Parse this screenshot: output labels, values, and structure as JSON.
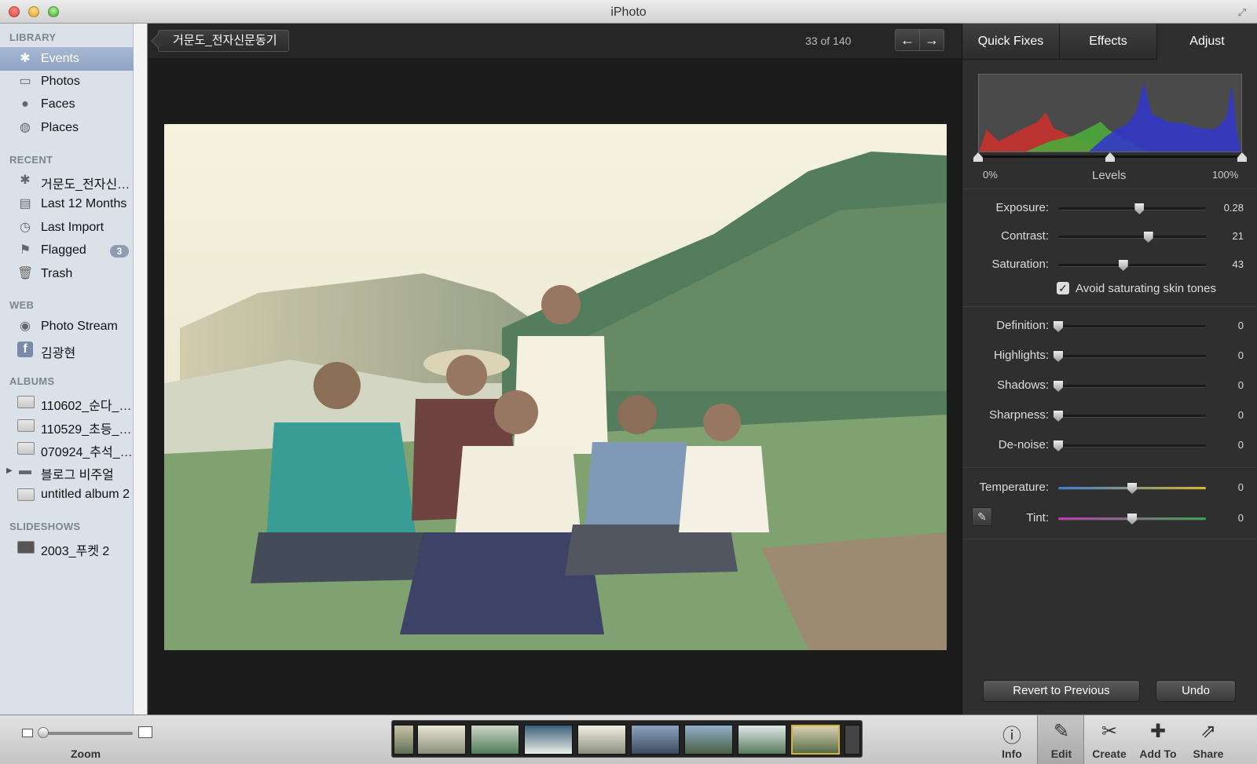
{
  "window": {
    "title": "iPhoto"
  },
  "sidebar": {
    "library_header": "LIBRARY",
    "library": [
      {
        "label": "Events",
        "icon": "palm-tree-icon",
        "selected": true
      },
      {
        "label": "Photos",
        "icon": "photos-icon"
      },
      {
        "label": "Faces",
        "icon": "person-icon"
      },
      {
        "label": "Places",
        "icon": "globe-icon"
      }
    ],
    "recent_header": "RECENT",
    "recent": [
      {
        "label": "거문도_전자신…",
        "icon": "palm-tree-icon"
      },
      {
        "label": "Last 12 Months",
        "icon": "calendar-icon"
      },
      {
        "label": "Last Import",
        "icon": "clock-icon"
      },
      {
        "label": "Flagged",
        "icon": "flag-icon",
        "badge": "3"
      },
      {
        "label": "Trash",
        "icon": "trash-icon"
      }
    ],
    "web_header": "WEB",
    "web": [
      {
        "label": "Photo Stream",
        "icon": "photo-stream-icon"
      },
      {
        "label": "김광현",
        "icon": "facebook-icon"
      }
    ],
    "albums_header": "ALBUMS",
    "albums": [
      {
        "label": "110602_순다_…",
        "icon": "album-icon"
      },
      {
        "label": "110529_초등_…",
        "icon": "album-icon"
      },
      {
        "label": "070924_추석_…",
        "icon": "album-icon"
      },
      {
        "label": "블로그 비주얼",
        "icon": "folder-icon"
      },
      {
        "label": "untitled album 2",
        "icon": "album-icon"
      }
    ],
    "slideshows_header": "SLIDESHOWS",
    "slideshows": [
      {
        "label": "2003_푸켓 2",
        "icon": "slideshow-icon"
      }
    ]
  },
  "viewer": {
    "breadcrumb": "거문도_전자신문동기",
    "counter": "33 of 140",
    "prev_icon": "arrow-left-icon",
    "next_icon": "arrow-right-icon"
  },
  "panel": {
    "tabs": [
      "Quick Fixes",
      "Effects",
      "Adjust"
    ],
    "active_tab": "Adjust",
    "levels": {
      "label": "Levels",
      "min": "0%",
      "max": "100%"
    },
    "sliders_top": [
      {
        "label": "Exposure:",
        "value": "0.28",
        "level": 0.55
      },
      {
        "label": "Contrast:",
        "value": "21",
        "level": 0.61
      },
      {
        "label": "Saturation:",
        "value": "43",
        "level": 0.44
      }
    ],
    "avoid_skin": {
      "label": "Avoid saturating skin tones",
      "checked": true
    },
    "sliders_mid": [
      {
        "label": "Definition:",
        "value": "0",
        "level": 0
      },
      {
        "label": "Highlights:",
        "value": "0",
        "level": 0
      },
      {
        "label": "Shadows:",
        "value": "0",
        "level": 0
      },
      {
        "label": "Sharpness:",
        "value": "0",
        "level": 0
      },
      {
        "label": "De-noise:",
        "value": "0",
        "level": 0
      }
    ],
    "sliders_color": [
      {
        "label": "Temperature:",
        "value": "0",
        "level": 0.5
      },
      {
        "label": "Tint:",
        "value": "0",
        "level": 0.5
      }
    ],
    "revert_label": "Revert to Previous",
    "undo_label": "Undo"
  },
  "bottom": {
    "zoom_label": "Zoom",
    "tools": [
      {
        "label": "Info",
        "icon": "info-icon"
      },
      {
        "label": "Edit",
        "icon": "pencil-icon"
      },
      {
        "label": "Create",
        "icon": "create-icon"
      },
      {
        "label": "Add To",
        "icon": "plus-icon"
      },
      {
        "label": "Share",
        "icon": "share-icon"
      }
    ]
  },
  "colors": {
    "selection": "#8ea3c4",
    "panel": "#2f2f2f",
    "sidebar": "#dbe1e9"
  }
}
